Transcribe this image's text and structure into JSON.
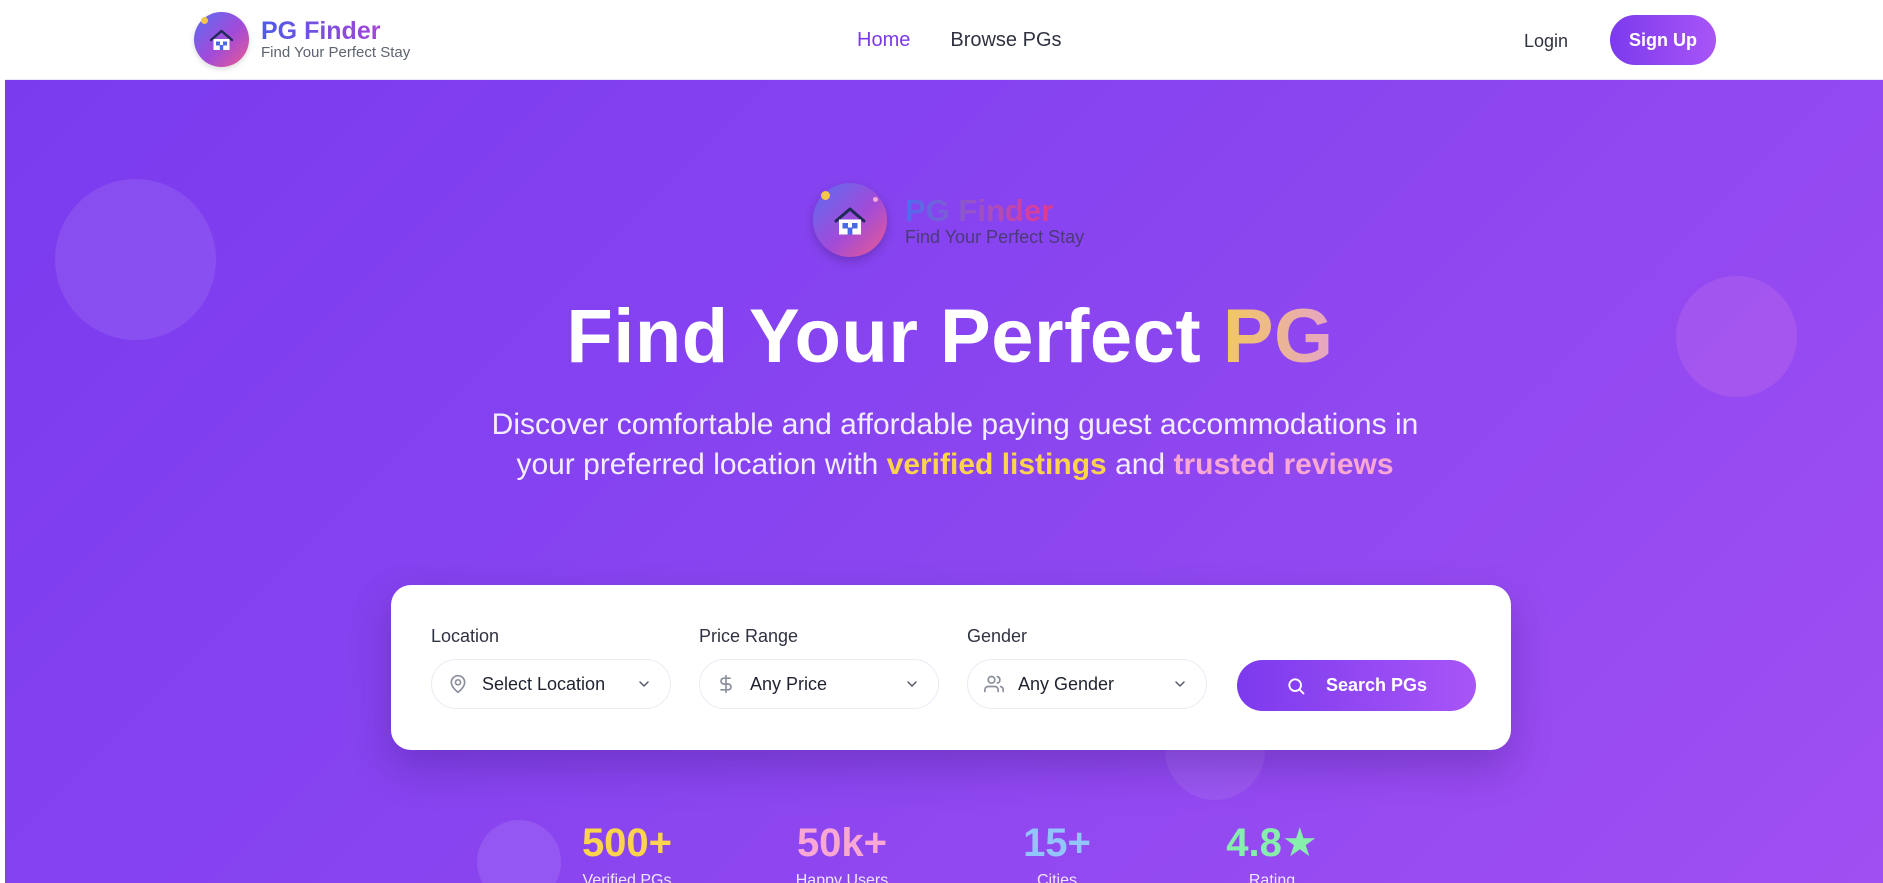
{
  "brand": {
    "name": "PG Finder",
    "tagline": "Find Your Perfect Stay"
  },
  "nav": {
    "links": [
      {
        "label": "Home",
        "active": true
      },
      {
        "label": "Browse PGs",
        "active": false
      }
    ],
    "login_label": "Login",
    "signup_label": "Sign Up"
  },
  "hero": {
    "logo_title": "PG Finder",
    "logo_tagline": "Find Your Perfect Stay",
    "title_main": "Find Your Perfect",
    "title_accent": "PG",
    "subtitle_start": "Discover comfortable and affordable paying guest accommodations in your preferred location with",
    "subtitle_highlight_1": "verified listings",
    "subtitle_and": "and",
    "subtitle_highlight_2": "trusted reviews"
  },
  "search": {
    "location_label": "Location",
    "location_value": "Select Location",
    "price_label": "Price Range",
    "price_value": "Any Price",
    "gender_label": "Gender",
    "gender_value": "Any Gender",
    "button_label": "Search PGs"
  },
  "stats": [
    {
      "value": "500+",
      "label": "Verified PGs",
      "color": "#fcd34d"
    },
    {
      "value": "50k+",
      "label": "Happy Users",
      "color": "#f9a8d4"
    },
    {
      "value": "15+",
      "label": "Cities",
      "color": "#93c5fd"
    },
    {
      "value": "4.8★",
      "label": "Rating",
      "color": "#86efac"
    }
  ],
  "colors": {
    "accent": "#7c3aed",
    "hero_bg": "#8b45f0",
    "highlight_yellow": "#fcd34d",
    "highlight_pink": "#f9a8d4"
  },
  "icons": [
    "house-icon",
    "map-pin-icon",
    "dollar-icon",
    "users-icon",
    "chevron-down-icon",
    "search-icon"
  ]
}
